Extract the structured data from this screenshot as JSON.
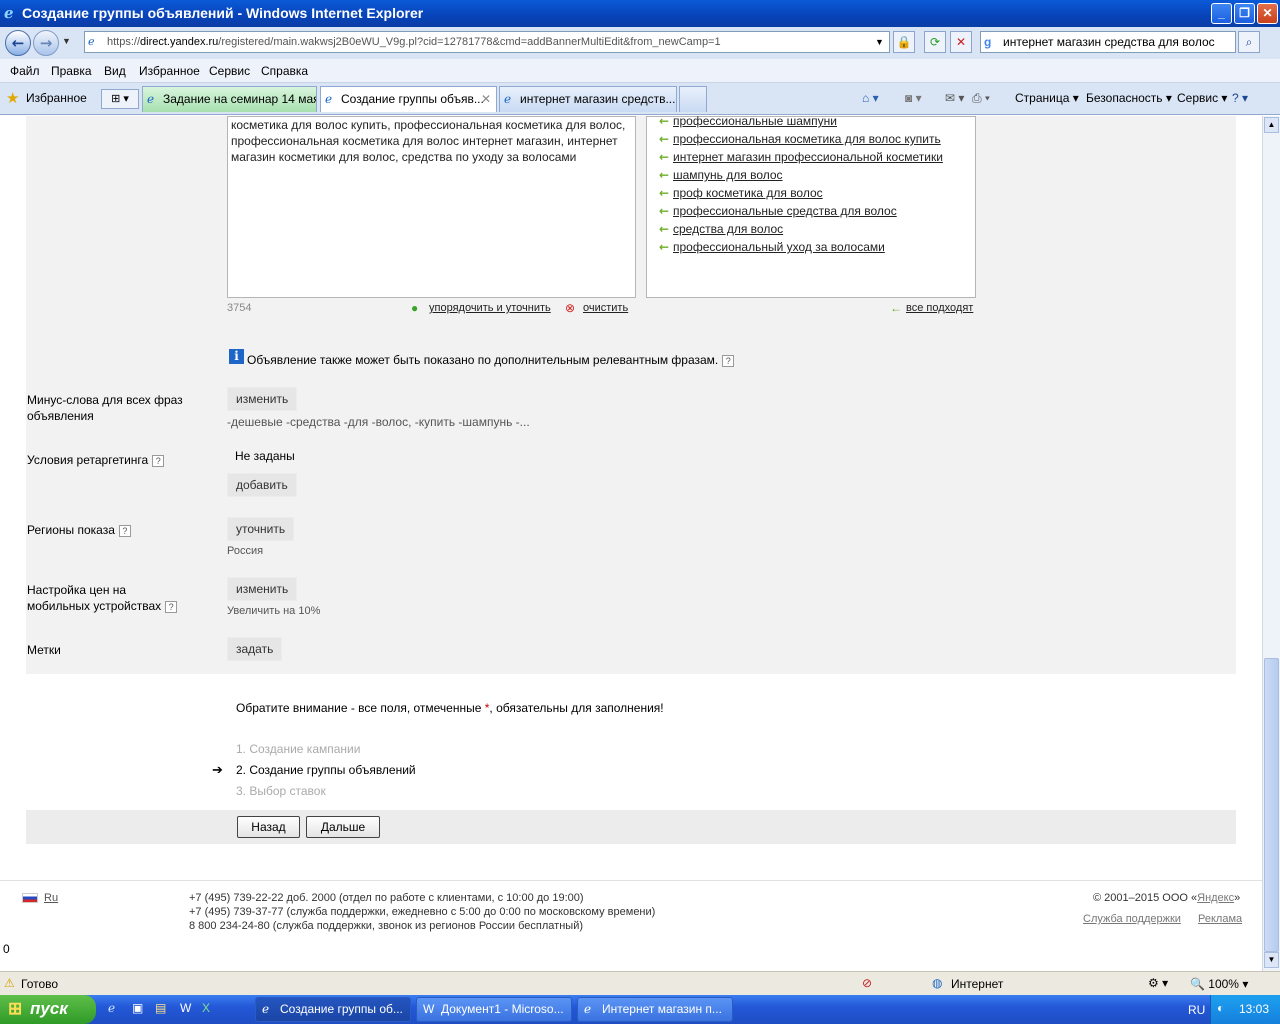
{
  "window": {
    "title": "Создание группы объявлений - Windows Internet Explorer",
    "url_prefix": "https://",
    "url_domain": "direct.yandex.ru",
    "url_path": "/registered/main.wakwsj2B0eWU_V9g.pl?cid=12781778&cmd=addBannerMultiEdit&from_newCamp=1",
    "search_text": "интернет магазин средства для волос"
  },
  "menu": [
    "Файл",
    "Правка",
    "Вид",
    "Избранное",
    "Сервис",
    "Справка"
  ],
  "favorites_label": "Избранное",
  "tabs": [
    {
      "label": "Задание на семинар 14 мая..."
    },
    {
      "label": "Создание группы объяв..."
    },
    {
      "label": "интернет магазин средств..."
    }
  ],
  "commands": {
    "page": "Страница",
    "security": "Безопасность",
    "service": "Сервис"
  },
  "form": {
    "phrases_text": "косметика для волос купить, профессиональная косметика для волос, профессиональная косметика для волос интернет магазин, интернет магазин косметики для волос, средства по уходу за волосами",
    "char_count": "3754",
    "sort_link": "упорядочить и уточнить",
    "clear_link": "очистить",
    "all_fit_link": "все подходят",
    "suggested_keywords": [
      "профессиональные шампуни",
      "профессиональная косметика для волос купить",
      "интернет магазин профессиональной косметики",
      "шампунь для волос",
      "проф косметика для волос",
      "профессиональные средства для волос",
      "средства для волос",
      "профессиональный уход за волосами"
    ],
    "info_note": "Объявление также может быть показано по дополнительным релевантным фразам.",
    "minus_label_1": "Минус-слова для всех фраз",
    "minus_label_2": "объявления",
    "minus_button": "изменить",
    "minus_words": "-дешевые -средства -для -волос, -купить -шампунь -...",
    "retarget_label": "Условия ретаргетинга",
    "retarget_value": "Не заданы",
    "retarget_button": "добавить",
    "regions_label": "Регионы показа",
    "regions_button": "уточнить",
    "regions_value": "Россия",
    "mobile_label_1": "Настройка цен на",
    "mobile_label_2": "мобильных устройствах",
    "mobile_button": "изменить",
    "mobile_value": "Увеличить на 10%",
    "tags_label": "Метки",
    "tags_button": "задать",
    "notice_before": "Обратите внимание - все поля, отмеченные ",
    "notice_star": "*",
    "notice_after": ", обязательны для заполнения!",
    "steps": [
      "1. Создание кампании",
      "2. Создание группы объявлений",
      "3. Выбор ставок"
    ],
    "back_button": "Назад",
    "next_button": "Дальше"
  },
  "footer": {
    "lang": "Ru",
    "phone1": "+7 (495) 739-22-22 доб. 2000 (отдел по работе с клиентами, с 10:00 до 19:00)",
    "phone2": "+7 (495) 739-37-77 (служба поддержки, ежедневно с 5:00 до 0:00 по московскому времени)",
    "phone3": "8 800 234-24-80 (служба поддержки, звонок из регионов России бесплатный)",
    "copyright_before": "© 2001–2015  ООО «",
    "copyright_link": "Яндекс",
    "copyright_after": "»",
    "support_link": "Служба поддержки",
    "ads_link": "Реклама",
    "zero": "0"
  },
  "status": {
    "text": "Готово",
    "zone": "Интернет",
    "zoom": "100%"
  },
  "taskbar": {
    "start": "пуск",
    "buttons": [
      "Создание группы об...",
      "Документ1 - Microso...",
      "Интернет магазин п..."
    ],
    "lang": "RU",
    "clock": "13:03"
  },
  "colors": {
    "accent": "#0a5ad8",
    "green_arrow": "#6fae2a",
    "required": "#cc0000"
  }
}
